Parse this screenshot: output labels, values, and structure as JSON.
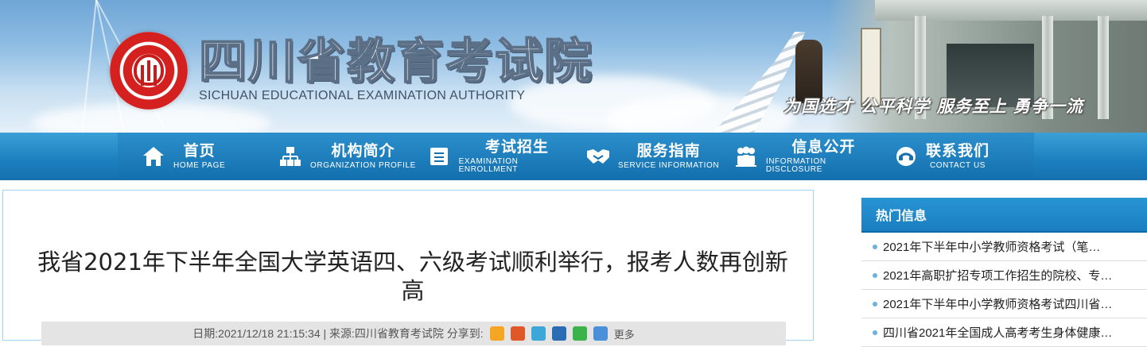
{
  "banner": {
    "title_cn": "四川省教育考试院",
    "title_en": "SICHUAN EDUCATIONAL EXAMINATION AUTHORITY",
    "slogan": "为国选才 公平科学 服务至上 勇争一流"
  },
  "nav": {
    "items": [
      {
        "label": "首页",
        "sub": "HOME PAGE",
        "icon": "home-icon"
      },
      {
        "label": "机构简介",
        "sub": "ORGANIZATION PROFILE",
        "icon": "org-chart-icon"
      },
      {
        "label": "考试招生",
        "sub": "EXAMINATION ENROLLMENT",
        "icon": "document-list-icon"
      },
      {
        "label": "服务指南",
        "sub": "SERVICE INFORMATION",
        "icon": "handshake-icon"
      },
      {
        "label": "信息公开",
        "sub": "INFORMATION DISCLOSURE",
        "icon": "people-icon"
      },
      {
        "label": "联系我们",
        "sub": "CONTACT US",
        "icon": "contact-icon"
      }
    ]
  },
  "article": {
    "title": "我省2021年下半年全国大学英语四、六级考试顺利举行，报考人数再创新高",
    "meta_text": "日期:2021/12/18 21:15:34 | 来源:四川省教育考试院  分享到:",
    "share_more": "更多"
  },
  "sidebar": {
    "heading": "热门信息",
    "items": [
      "2021年下半年中小学教师资格考试（笔…",
      "2021年高职扩招专项工作招生的院校、专…",
      "2021年下半年中小学教师资格考试四川省…",
      "四川省2021年全国成人高考考生身体健康…"
    ]
  },
  "colors": {
    "nav_blue": "#1b7fbf",
    "sidebar_head": "#1a7fc0",
    "seal_red": "#d52020"
  }
}
